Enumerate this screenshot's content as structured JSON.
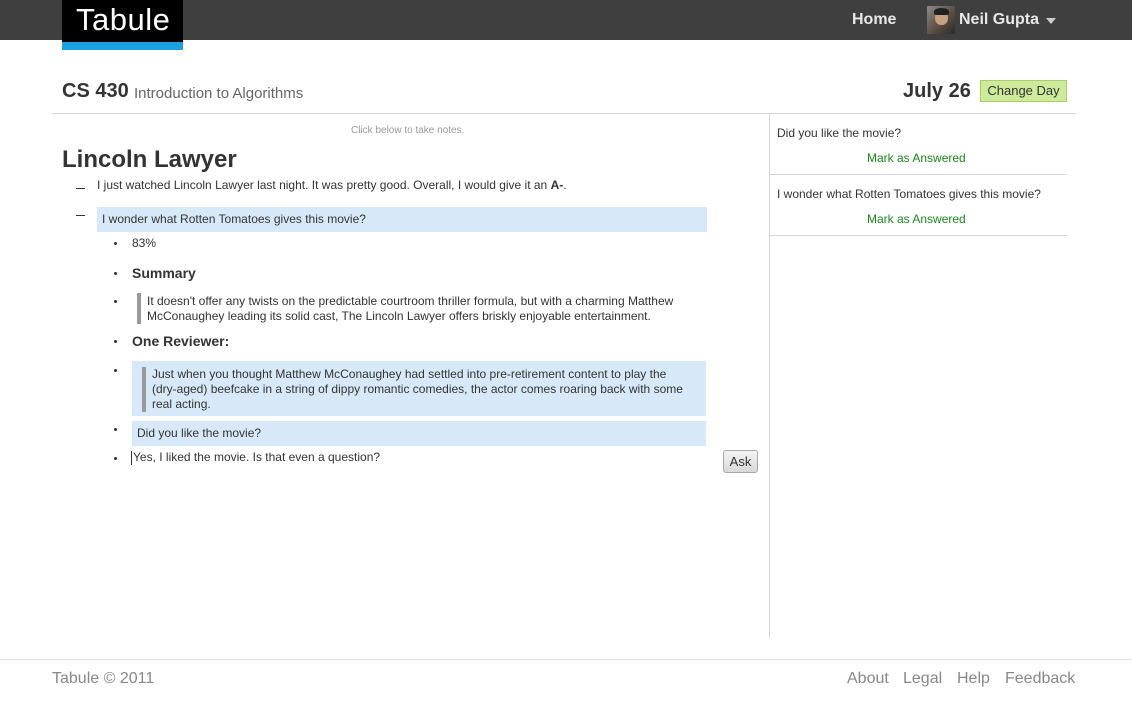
{
  "header": {
    "logo_text": "Tabule",
    "nav_home": "Home",
    "user_name": "Neil Gupta"
  },
  "course": {
    "code": "CS 430",
    "name": "Introduction to Algorithms",
    "date": "July 26",
    "change_day_label": "Change Day"
  },
  "notes": {
    "hint": "Click below to take notes.",
    "title": "Lincoln Lawyer",
    "line1_text": "I just watched Lincoln Lawyer last night. It was pretty good. Overall, I would give it an ",
    "line1_grade": "A-",
    "line1_end": ".",
    "question1": "I wonder what Rotten Tomatoes gives this movie?",
    "score": "83%",
    "summary_label": "Summary",
    "summary_line1": "It doesn't offer any twists on the predictable courtroom thriller formula, but with a charming Matthew",
    "summary_line2": "McConaughey leading its solid cast, The Lincoln Lawyer offers briskly enjoyable entertainment.",
    "reviewer_label": "One Reviewer:",
    "review_line1": "Just when you thought Matthew McConaughey had settled into pre-retirement content to play the",
    "review_line2": "(dry-aged) beefcake in a string of dippy romantic comedies, the actor comes roaring back with some",
    "review_line3": "real acting.",
    "question2": "Did you like the movie?",
    "answer_input": "Yes, I liked the movie. Is that even a question?",
    "ask_label": "Ask"
  },
  "questions_panel": {
    "items": [
      {
        "text": "Did you like the movie?",
        "action": "Mark as Answered"
      },
      {
        "text": "I wonder what Rotten Tomatoes gives this movie?",
        "action": "Mark as Answered"
      }
    ]
  },
  "footer": {
    "copyright": "Tabule © 2011",
    "links": [
      "About",
      "Legal",
      "Help",
      "Feedback"
    ]
  },
  "colors": {
    "topbar": "#3f3f3f",
    "logo_accent": "#1ba1e2",
    "change_day_bg": "#cdeb9b",
    "highlight": "#d7e9f8",
    "answered_link": "#1a8a1a"
  }
}
